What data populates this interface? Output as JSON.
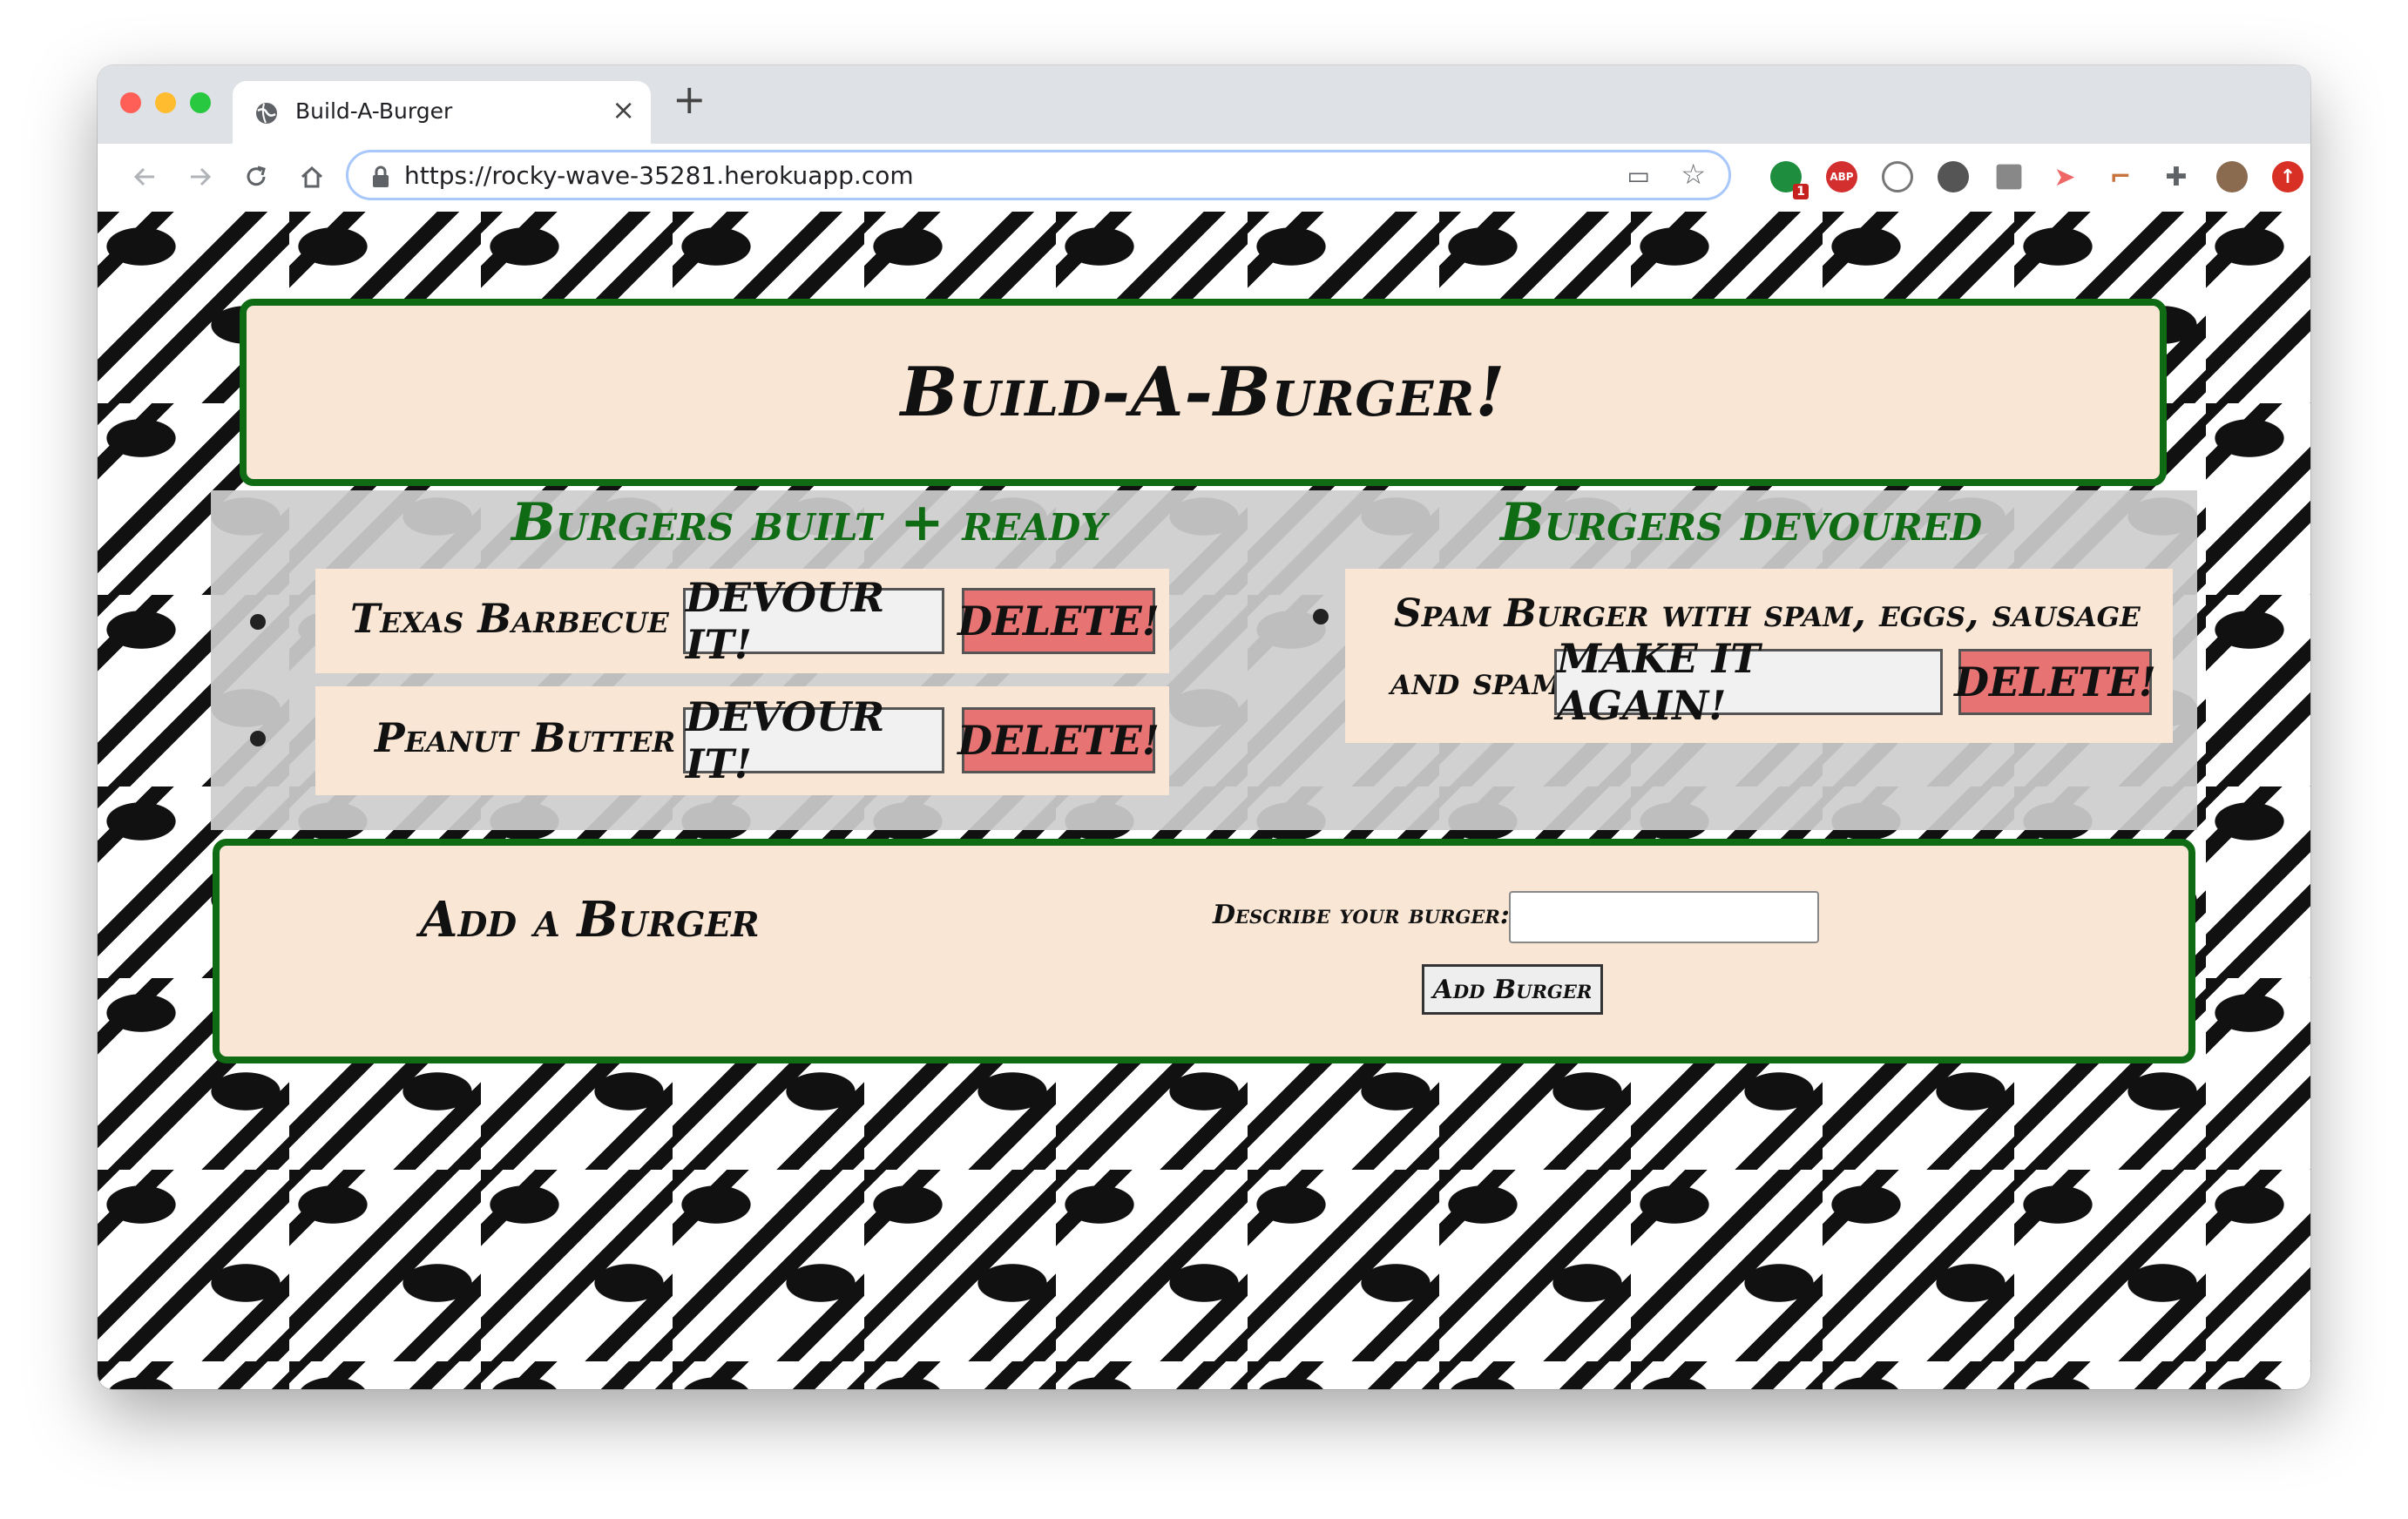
{
  "browser": {
    "tab_title": "Build-A-Burger",
    "tab_close": "×",
    "new_tab": "+",
    "url": "https://rocky-wave-35281.herokuapp.com",
    "extension_badge": "1",
    "abp_label": "ABP"
  },
  "header": {
    "title": "Build-A-Burger!"
  },
  "ready": {
    "title": "Burgers built + ready",
    "items": [
      {
        "name": "Texas Barbecue",
        "devour_label": "DEVOUR IT!",
        "delete_label": "DELETE!"
      },
      {
        "name": "Peanut Butter",
        "devour_label": "DEVOUR IT!",
        "delete_label": "DELETE!"
      }
    ]
  },
  "devoured": {
    "title": "Burgers devoured",
    "items": [
      {
        "name_line1": "Spam Burger with spam, eggs, sausage",
        "name_line2": "and spam",
        "again_label": "MAKE IT AGAIN!",
        "delete_label": "DELETE!"
      }
    ]
  },
  "add": {
    "title": "Add a Burger",
    "label": "Describe your burger:",
    "input_value": "",
    "button_label": "Add Burger"
  },
  "colors": {
    "accent_green": "#0f6b14",
    "card_bg": "#f9e6d4",
    "delete_red": "#e87373"
  }
}
